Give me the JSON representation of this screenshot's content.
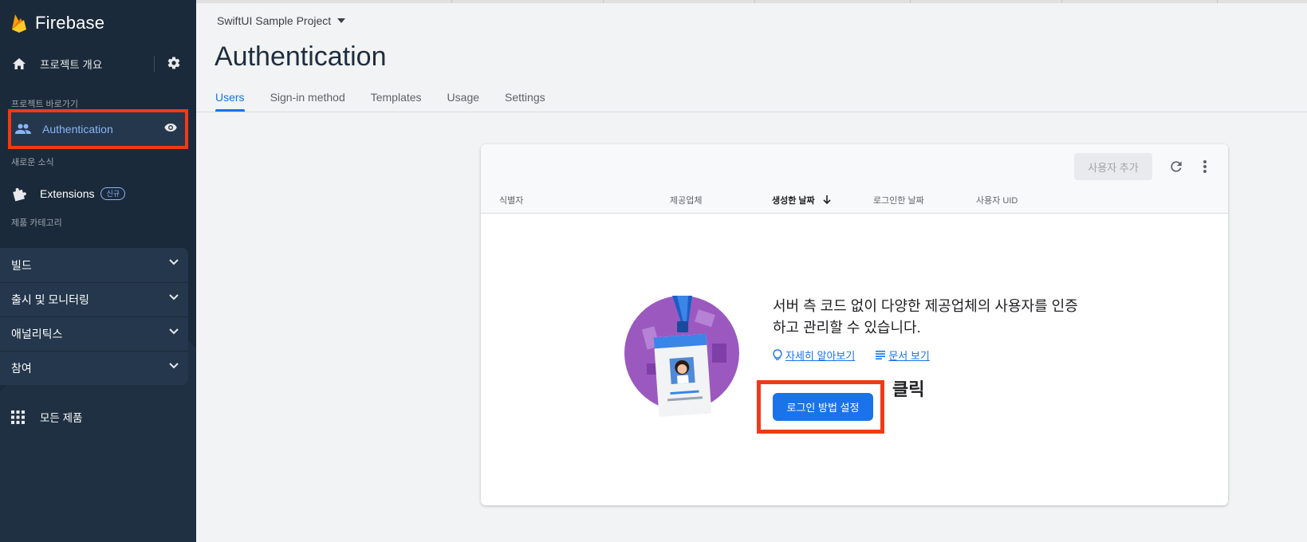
{
  "sidebar": {
    "brand": "Firebase",
    "overview_label": "프로젝트 개요",
    "shortcuts_section": "프로젝트 바로가기",
    "auth_label": "Authentication",
    "news_section": "새로운 소식",
    "extensions_label": "Extensions",
    "extensions_badge": "신규",
    "categories_section": "제품 카테고리",
    "categories": [
      {
        "label": "빌드"
      },
      {
        "label": "출시 및 모니터링"
      },
      {
        "label": "애널리틱스"
      },
      {
        "label": "참여"
      }
    ],
    "all_products_label": "모든 제품"
  },
  "header": {
    "project": "SwiftUI Sample Project",
    "title": "Authentication",
    "tabs": [
      {
        "label": "Users"
      },
      {
        "label": "Sign-in method"
      },
      {
        "label": "Templates"
      },
      {
        "label": "Usage"
      },
      {
        "label": "Settings"
      }
    ]
  },
  "users_card": {
    "add_user_label": "사용자 추가",
    "columns": [
      {
        "label": "식별자"
      },
      {
        "label": "제공업체"
      },
      {
        "label": "생성한 날짜"
      },
      {
        "label": "로그인한 날짜"
      },
      {
        "label": "사용자 UID"
      }
    ],
    "empty_text": "서버 측 코드 없이 다양한 제공업체의 사용자를 인증하고 관리할 수 있습니다.",
    "learn_more": "자세히 알아보기",
    "docs": "문서 보기",
    "cta_label": "로그인 방법 설정",
    "annotation": "클릭"
  },
  "colors": {
    "accent": "#1a73e8",
    "sidebar_bg": "#1b2a3a",
    "highlight_frame": "#f03a17"
  }
}
